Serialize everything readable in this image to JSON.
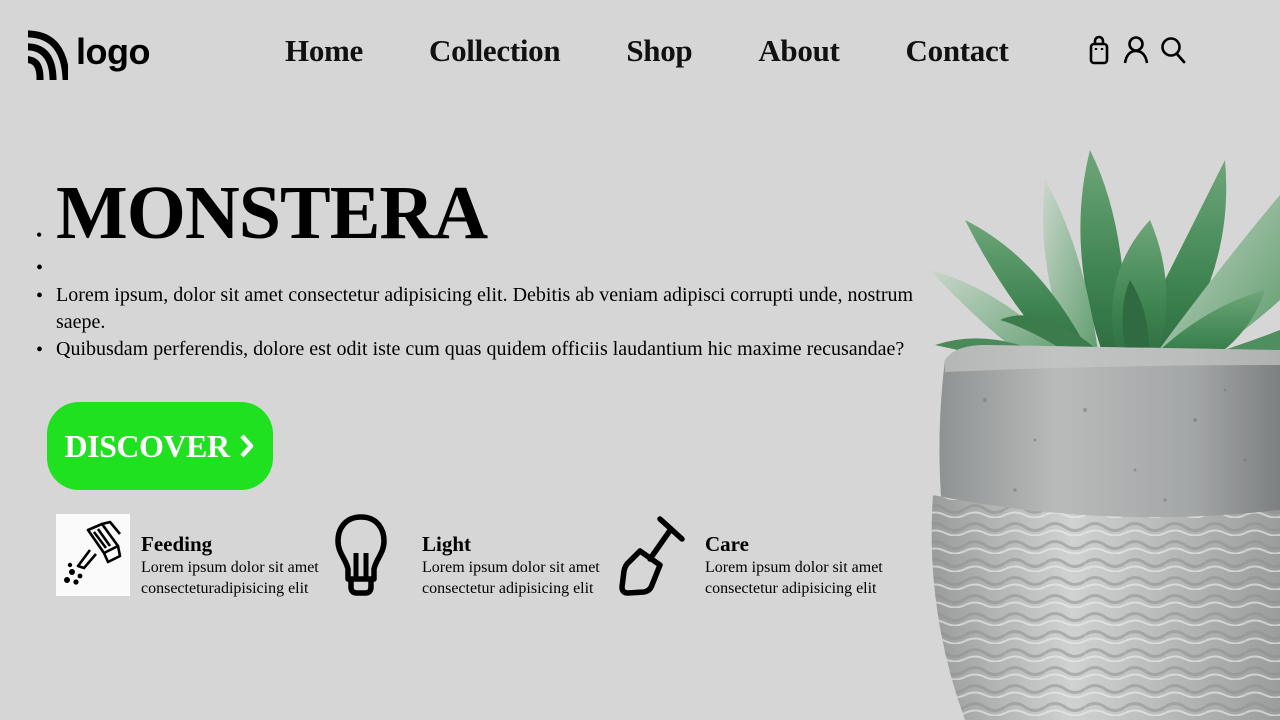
{
  "header": {
    "logo_text": "logo",
    "nav": [
      "Home",
      "Collection",
      "Shop",
      "About",
      "Contact"
    ],
    "icons": [
      "shopping-bag-icon",
      "user-icon",
      "search-icon"
    ]
  },
  "hero": {
    "title": "MONSTERA",
    "paragraph_lines": [
      "Lorem ipsum, dolor sit amet consectetur adipisicing elit. Debitis ab veniam adipisci corrupti unde, nostrum saepe.",
      "Quibusdam perferendis, dolore est odit iste cum quas quidem officiis laudantium hic maxime recusandae?"
    ],
    "cta_label": "DISCOVER"
  },
  "features": [
    {
      "icon": "watering-can-icon",
      "title": "Feeding",
      "desc": "Lorem ipsum dolor sit amet consecteturadipisicing elit"
    },
    {
      "icon": "light-bulb-icon",
      "title": "Light",
      "desc": "Lorem ipsum dolor sit amet consectetur adipisicing elit"
    },
    {
      "icon": "shovel-icon",
      "title": "Care",
      "desc": "Lorem ipsum dolor sit amet consectetur adipisicing elit"
    }
  ],
  "colors": {
    "background": "#d6d6d6",
    "cta": "#1fe11f",
    "leaf": "#3f8a4f",
    "pot": "#a9abab"
  }
}
